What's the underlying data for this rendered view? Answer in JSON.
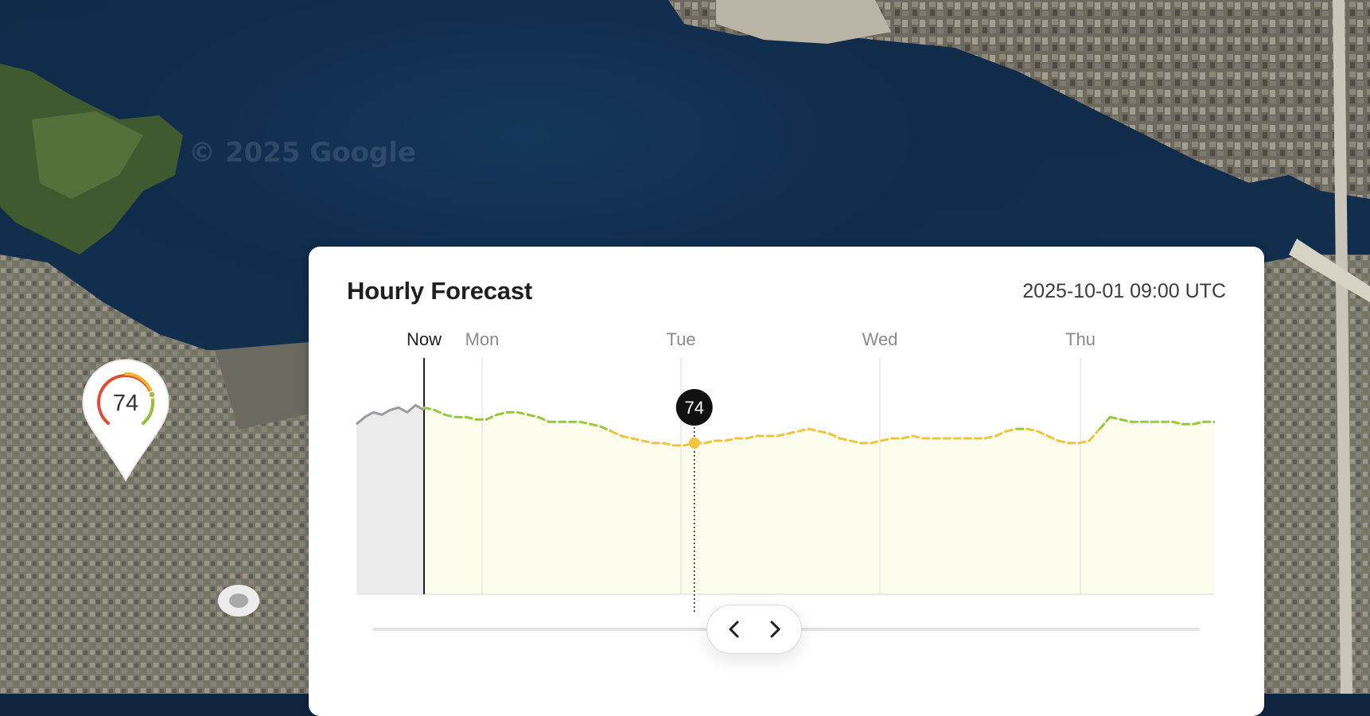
{
  "map": {
    "watermark": "© 2025 Google",
    "marker": {
      "aqi": "74"
    }
  },
  "forecast": {
    "title": "Hourly Forecast",
    "timestamp": "2025-10-01 09:00 UTC",
    "now_label": "Now",
    "day_labels": [
      "Mon",
      "Tue",
      "Wed",
      "Thu"
    ],
    "selected_value": "74",
    "colors": {
      "history_line": "#9a9ba0",
      "history_fill": "#ebebeb",
      "good": "#97c93c",
      "moderate": "#f0c43c",
      "fill": "#fdfdee"
    },
    "nav": {
      "prev_icon": "chevron-left-icon",
      "next_icon": "chevron-right-icon"
    }
  },
  "chart_data": {
    "type": "line",
    "x_unit": "hours",
    "history": [
      72,
      75,
      77,
      76,
      78,
      79,
      77,
      80,
      78
    ],
    "series": [
      {
        "values": [
          79,
          78,
          76,
          75,
          75,
          74,
          74,
          76,
          77,
          77,
          76,
          75,
          73,
          73,
          73,
          73,
          72,
          71,
          69,
          67,
          66,
          65,
          64,
          64,
          63,
          63,
          64,
          64,
          65,
          65,
          66,
          66,
          67,
          67,
          67,
          68,
          69,
          70,
          69,
          68,
          66,
          65,
          64,
          64,
          65,
          66,
          66,
          67,
          66,
          66,
          66,
          66,
          66,
          66,
          66,
          67,
          69,
          70,
          70,
          69,
          67,
          65,
          64,
          64,
          65,
          70,
          75,
          74,
          73,
          73,
          73,
          73,
          73,
          72,
          72,
          73,
          73
        ]
      }
    ],
    "ylim": [
      0,
      100
    ]
  }
}
